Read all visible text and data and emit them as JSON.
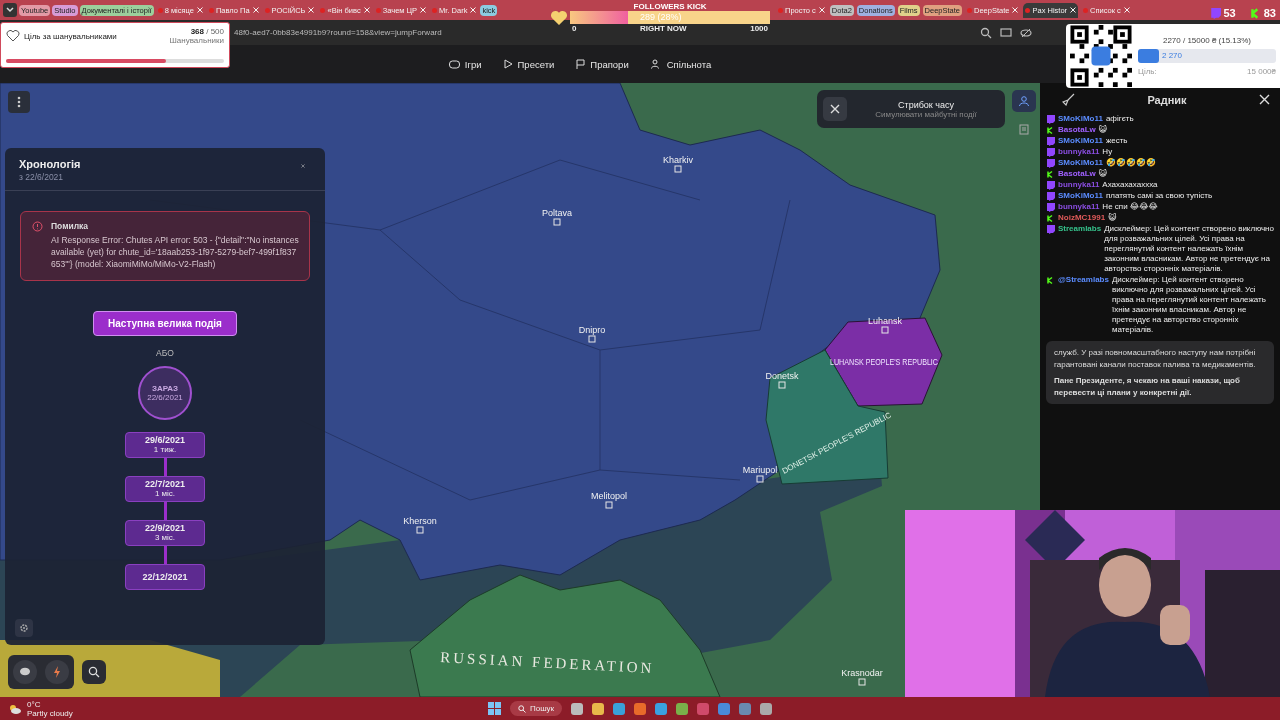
{
  "browser": {
    "tabs": [
      {
        "kind": "group",
        "label": "Youtube",
        "color": "#e39aa6"
      },
      {
        "kind": "group",
        "label": "Studio",
        "color": "#d79bd6"
      },
      {
        "kind": "group",
        "label": "Документалі і історії",
        "color": "#9ccf9c"
      },
      {
        "kind": "tab",
        "label": "8 місяце",
        "selected": false
      },
      {
        "kind": "tab",
        "label": "Павло Па",
        "selected": false
      },
      {
        "kind": "tab",
        "label": "РОСІЙСЬ",
        "selected": false
      },
      {
        "kind": "tab",
        "label": "«Він бивс",
        "selected": false
      },
      {
        "kind": "tab",
        "label": "Зачем ЦР",
        "selected": false
      },
      {
        "kind": "tab",
        "label": "Mr. Dark",
        "selected": false
      },
      {
        "kind": "group",
        "label": "kick",
        "color": "#8ccbe0"
      },
      {
        "kind": "gap"
      },
      {
        "kind": "tab",
        "label": "Просто с",
        "selected": false
      },
      {
        "kind": "group",
        "label": "Dota2",
        "color": "#bfbfbf"
      },
      {
        "kind": "group",
        "label": "Donations",
        "color": "#9fb0e0"
      },
      {
        "kind": "group",
        "label": "Films",
        "color": "#e0d08a"
      },
      {
        "kind": "group",
        "label": "DeepState",
        "color": "#e0a080"
      },
      {
        "kind": "tab",
        "label": "DeepState",
        "selected": false
      },
      {
        "kind": "tab",
        "label": "Pax Histor",
        "selected": true
      },
      {
        "kind": "tab",
        "label": "Список с",
        "selected": false
      }
    ],
    "address": "48f0-aed7-0bb83e4991b9?round=158&view=jumpForward"
  },
  "nav": [
    "Ігри",
    "Пресети",
    "Прапори",
    "Спільнота"
  ],
  "follower_goal": {
    "title": "Ціль за шанувальниками",
    "count": "368",
    "total": "/ 500",
    "unit": "Шанувальники",
    "level": 0.736
  },
  "kick_goal": {
    "title": "FOLLOWERS KICK",
    "reading": "289 (28%)",
    "level": 0.289,
    "start": "0",
    "middle": "RIGHT NOW",
    "end": "1000"
  },
  "viewers": [
    {
      "kind": "twitch",
      "count": "53"
    },
    {
      "kind": "kick",
      "count": "83"
    }
  ],
  "donation": {
    "reading": "2270 / 15000 ₴ (15.13%)",
    "amount": "2 270",
    "level": 0.1513,
    "goal_label": "Ціль:",
    "goal": "15 000₴"
  },
  "time_jump": {
    "title": "Стрибок часу",
    "subtitle": "Симулювати майбутні події"
  },
  "chronology": {
    "title": "Хронологія",
    "since": "з 22/6/2021",
    "error": {
      "title": "Помилка",
      "message": "AI Response Error: Chutes API error: 503 - {\"detail\":\"No instances available (yet) for chute_id='18aab253-1f97-5279-bef7-499f1f837653'\"} (model: XiaomiMiMo/MiMo-V2-Flash)"
    },
    "next_button": "Наступна велика подія",
    "or": "АБО",
    "now_label": "ЗАРАЗ",
    "now_date": "22/6/2021",
    "steps": [
      {
        "date": "29/6/2021",
        "span": "1 тиж."
      },
      {
        "date": "22/7/2021",
        "span": "1 міс."
      },
      {
        "date": "22/9/2021",
        "span": "3 міс."
      },
      {
        "date": "22/12/2021"
      }
    ]
  },
  "map": {
    "labels": [
      {
        "kind": "region",
        "text": "RUSSIAN FEDERATION"
      },
      {
        "kind": "region",
        "text": "LUHANSK PEOPLE'S REPUBLIC"
      },
      {
        "kind": "region",
        "text": "DONETSK PEOPLE'S REPUBLIC"
      },
      {
        "kind": "city",
        "text": "Kharkiv"
      },
      {
        "kind": "city",
        "text": "Dnipro"
      },
      {
        "kind": "city",
        "text": "Donetsk"
      },
      {
        "kind": "city",
        "text": "Luhansk"
      },
      {
        "kind": "city",
        "text": "Mariupol"
      },
      {
        "kind": "city",
        "text": "Poltava"
      },
      {
        "kind": "city",
        "text": "Kherson"
      },
      {
        "kind": "city",
        "text": "Melitopol"
      },
      {
        "kind": "city",
        "text": "Krasnodar"
      }
    ]
  },
  "advisor": {
    "title": "Радник",
    "chat": [
      {
        "kind": "twitch",
        "user": "SMoKiMo11",
        "color": "#5b8cff",
        "text": "афігєть"
      },
      {
        "kind": "kick",
        "user": "BasotaLw",
        "color": "#a060ff",
        "text": "😺"
      },
      {
        "kind": "twitch",
        "user": "SMoKiMo11",
        "color": "#5b8cff",
        "text": "жесть"
      },
      {
        "kind": "twitch",
        "user": "bunnyka11",
        "color": "#8a4de0",
        "text": "Ну"
      },
      {
        "kind": "twitch",
        "user": "SMoKiMo11",
        "color": "#5b8cff",
        "text": "🤣🤣🤣🤣🤣"
      },
      {
        "kind": "kick",
        "user": "BasotaLw",
        "color": "#a060ff",
        "text": "😺"
      },
      {
        "kind": "twitch",
        "user": "bunnyka11",
        "color": "#8a4de0",
        "text": "Ахахахахаххха"
      },
      {
        "kind": "twitch",
        "user": "SMoKiMo11",
        "color": "#5b8cff",
        "text": "платять самі за свою тупість"
      },
      {
        "kind": "twitch",
        "user": "bunnyka11",
        "color": "#8a4de0",
        "text": "Не спи 😂😂😂"
      },
      {
        "kind": "kick",
        "user": "NoizMC1991",
        "color": "#e05a5a",
        "text": "😺"
      },
      {
        "kind": "twitch",
        "user": "Streamlabs",
        "color": "#35c08a",
        "text": "Дисклеймер: Цей контент створено виключно для розважальних цілей. Усі права на переглянутий контент належать їхнім законним власникам. Автор не претендує на авторство сторонніх матеріалів."
      },
      {
        "kind": "kick",
        "user": "@Streamlabs",
        "color": "#5b8cff",
        "text": "Дисклеймер: Цей контент створено виключно для розважальних цілей. Усі права на переглянутий контент належать їхнім законним власникам. Автор не претендує на авторство сторонніх матеріалів."
      }
    ],
    "paragraphs": [
      {
        "kind": "plain",
        "text": "служб. У разі повномасштабного наступу нам потрібні гарантовані канали поставок палива та медикаментів."
      },
      {
        "kind": "bold",
        "text": "Пане Президенте, я чекаю на ваші накази, щоб перевести ці плани у конкретні дії."
      }
    ]
  },
  "taskbar": {
    "temperature": "0°C",
    "weather": "Partly cloudy",
    "search": "Пошук"
  }
}
